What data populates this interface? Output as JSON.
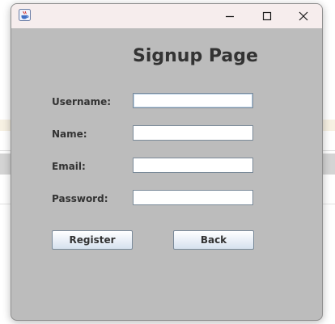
{
  "window": {
    "controls": {
      "minimize_icon": "minimize-icon",
      "maximize_icon": "maximize-icon",
      "close_icon": "close-icon"
    },
    "app_icon": "java-cup-icon"
  },
  "form": {
    "title": "Signup Page",
    "fields": {
      "username": {
        "label": "Username:",
        "value": ""
      },
      "name": {
        "label": "Name:",
        "value": ""
      },
      "email": {
        "label": "Email:",
        "value": ""
      },
      "password": {
        "label": "Password:",
        "value": ""
      }
    },
    "buttons": {
      "register": "Register",
      "back": "Back"
    }
  },
  "colors": {
    "window_background": "#bcbcbc",
    "titlebar_background": "#f6eded",
    "text": "#333333"
  }
}
